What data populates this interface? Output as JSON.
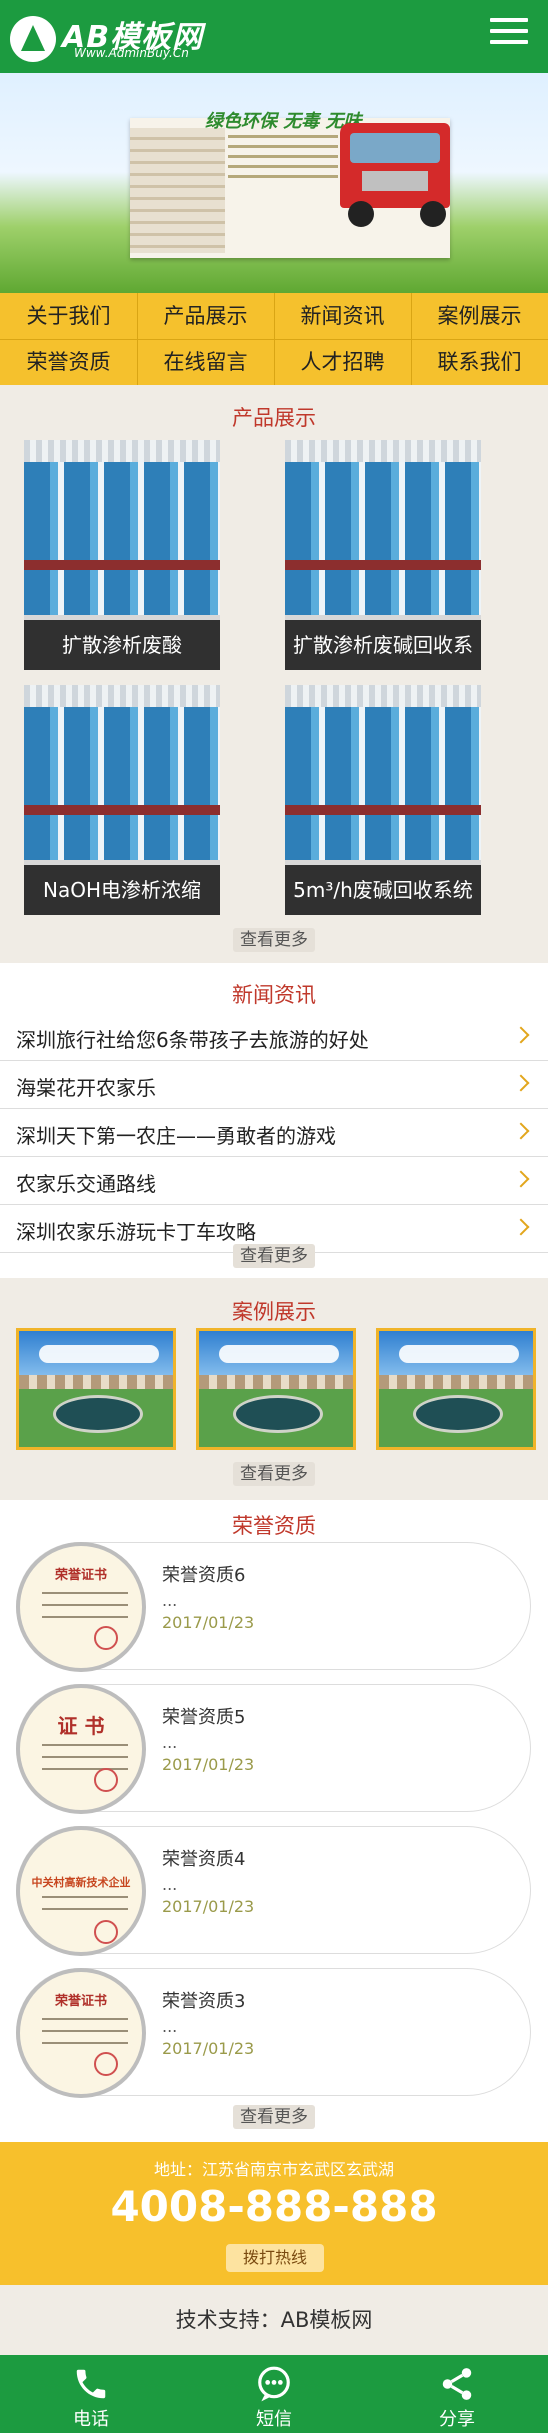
{
  "header": {
    "logo_text": "AB模板网",
    "logo_url": "Www.AdminBuy.Cn",
    "menu_icon": "hamburger-menu-icon"
  },
  "banner": {
    "slogan": "绿色环保 无毒 无味"
  },
  "nav": {
    "items": [
      "关于我们",
      "产品展示",
      "新闻资讯",
      "案例展示",
      "荣誉资质",
      "在线留言",
      "人才招聘",
      "联系我们"
    ]
  },
  "products": {
    "title": "产品展示",
    "items": [
      "扩散渗析废酸",
      "扩散渗析废碱回收系统",
      "NaOH电渗析浓缩",
      "5m³/h废碱回收系统"
    ],
    "more": "查看更多"
  },
  "news": {
    "title": "新闻资讯",
    "items": [
      "深圳旅行社给您6条带孩子去旅游的好处",
      "海棠花开农家乐",
      "深圳天下第一农庄——勇敢者的游戏",
      "农家乐交通路线",
      "深圳农家乐游玩卡丁车攻略"
    ],
    "more": "查看更多"
  },
  "cases": {
    "title": "案例展示",
    "more": "查看更多"
  },
  "honors": {
    "title": "荣誉资质",
    "items": [
      {
        "name": "荣誉资质6",
        "desc": "...",
        "date": "2017/01/23",
        "cert": "荣誉证书"
      },
      {
        "name": "荣誉资质5",
        "desc": "...",
        "date": "2017/01/23",
        "cert": "证 书"
      },
      {
        "name": "荣誉资质4",
        "desc": "...",
        "date": "2017/01/23",
        "cert": "中关村高新技术企业"
      },
      {
        "name": "荣誉资质3",
        "desc": "...",
        "date": "2017/01/23",
        "cert": "荣誉证书"
      }
    ],
    "more": "查看更多"
  },
  "contact": {
    "address": "地址：江苏省南京市玄武区玄武湖",
    "phone": "4008-888-888",
    "call_label": "拨打热线"
  },
  "support": "技术支持：AB模板网",
  "bottom_bar": {
    "items": [
      {
        "label": "电话",
        "icon": "phone-icon"
      },
      {
        "label": "短信",
        "icon": "sms-icon"
      },
      {
        "label": "分享",
        "icon": "share-icon"
      }
    ]
  },
  "colors": {
    "primary_green": "#1c9b40",
    "nav_yellow": "#f5c12d",
    "title_red": "#c0382b",
    "background": "#f0ece5"
  }
}
